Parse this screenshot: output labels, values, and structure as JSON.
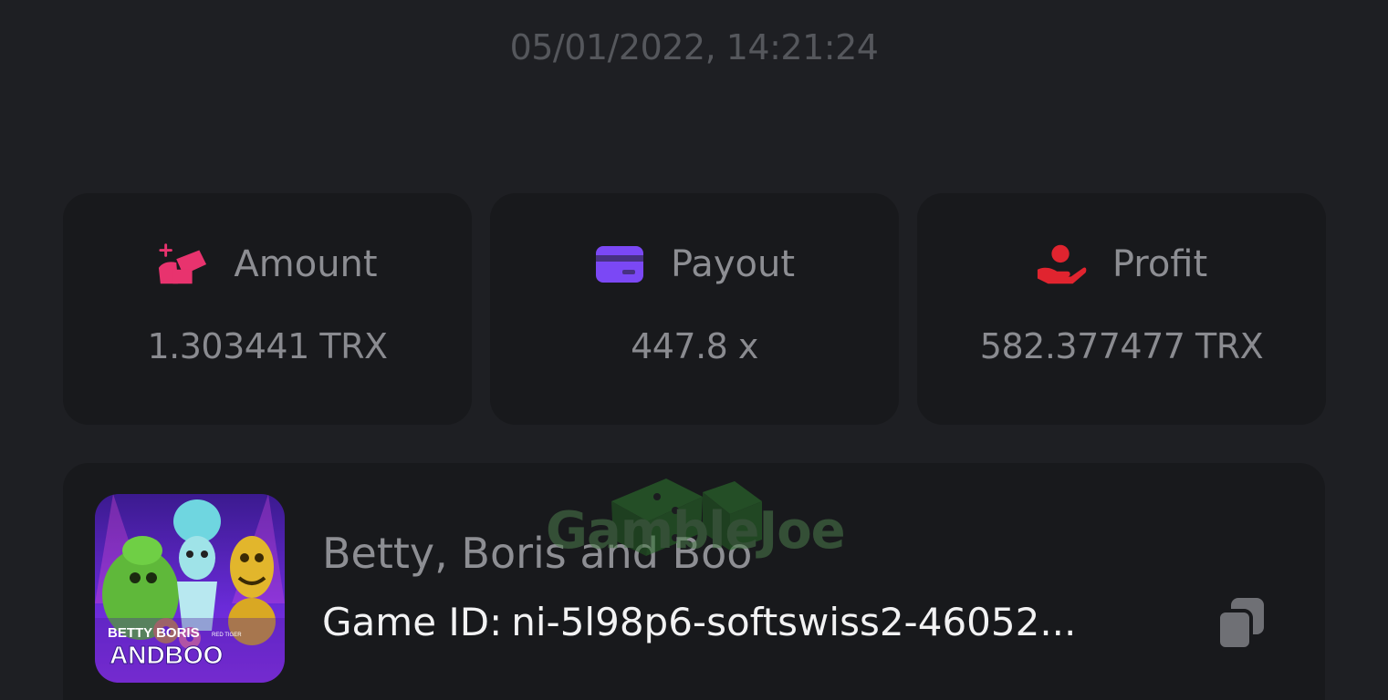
{
  "timestamp": "05/01/2022, 14:21:24",
  "stats": {
    "amount": {
      "label": "Amount",
      "value": "1.303441 TRX",
      "icon": "wallet-sparkle-icon",
      "color": "#e8336e"
    },
    "payout": {
      "label": "Payout",
      "value": "447.8 x",
      "icon": "credit-card-icon",
      "color": "#7b48f5"
    },
    "profit": {
      "label": "Profit",
      "value": "582.377477 TRX",
      "icon": "hand-user-icon",
      "color": "#e0242f"
    }
  },
  "game": {
    "name": "Betty, Boris and Boo",
    "id_label": "Game ID:",
    "id_value": "ni-5l98p6-softswiss2-46052...",
    "thumbnail_title_line1": "BETTY BORIS",
    "thumbnail_title_line2": "ANDBOO",
    "thumbnail_badge": "RED TIGER"
  },
  "watermark": {
    "text": "GambleJoe"
  }
}
